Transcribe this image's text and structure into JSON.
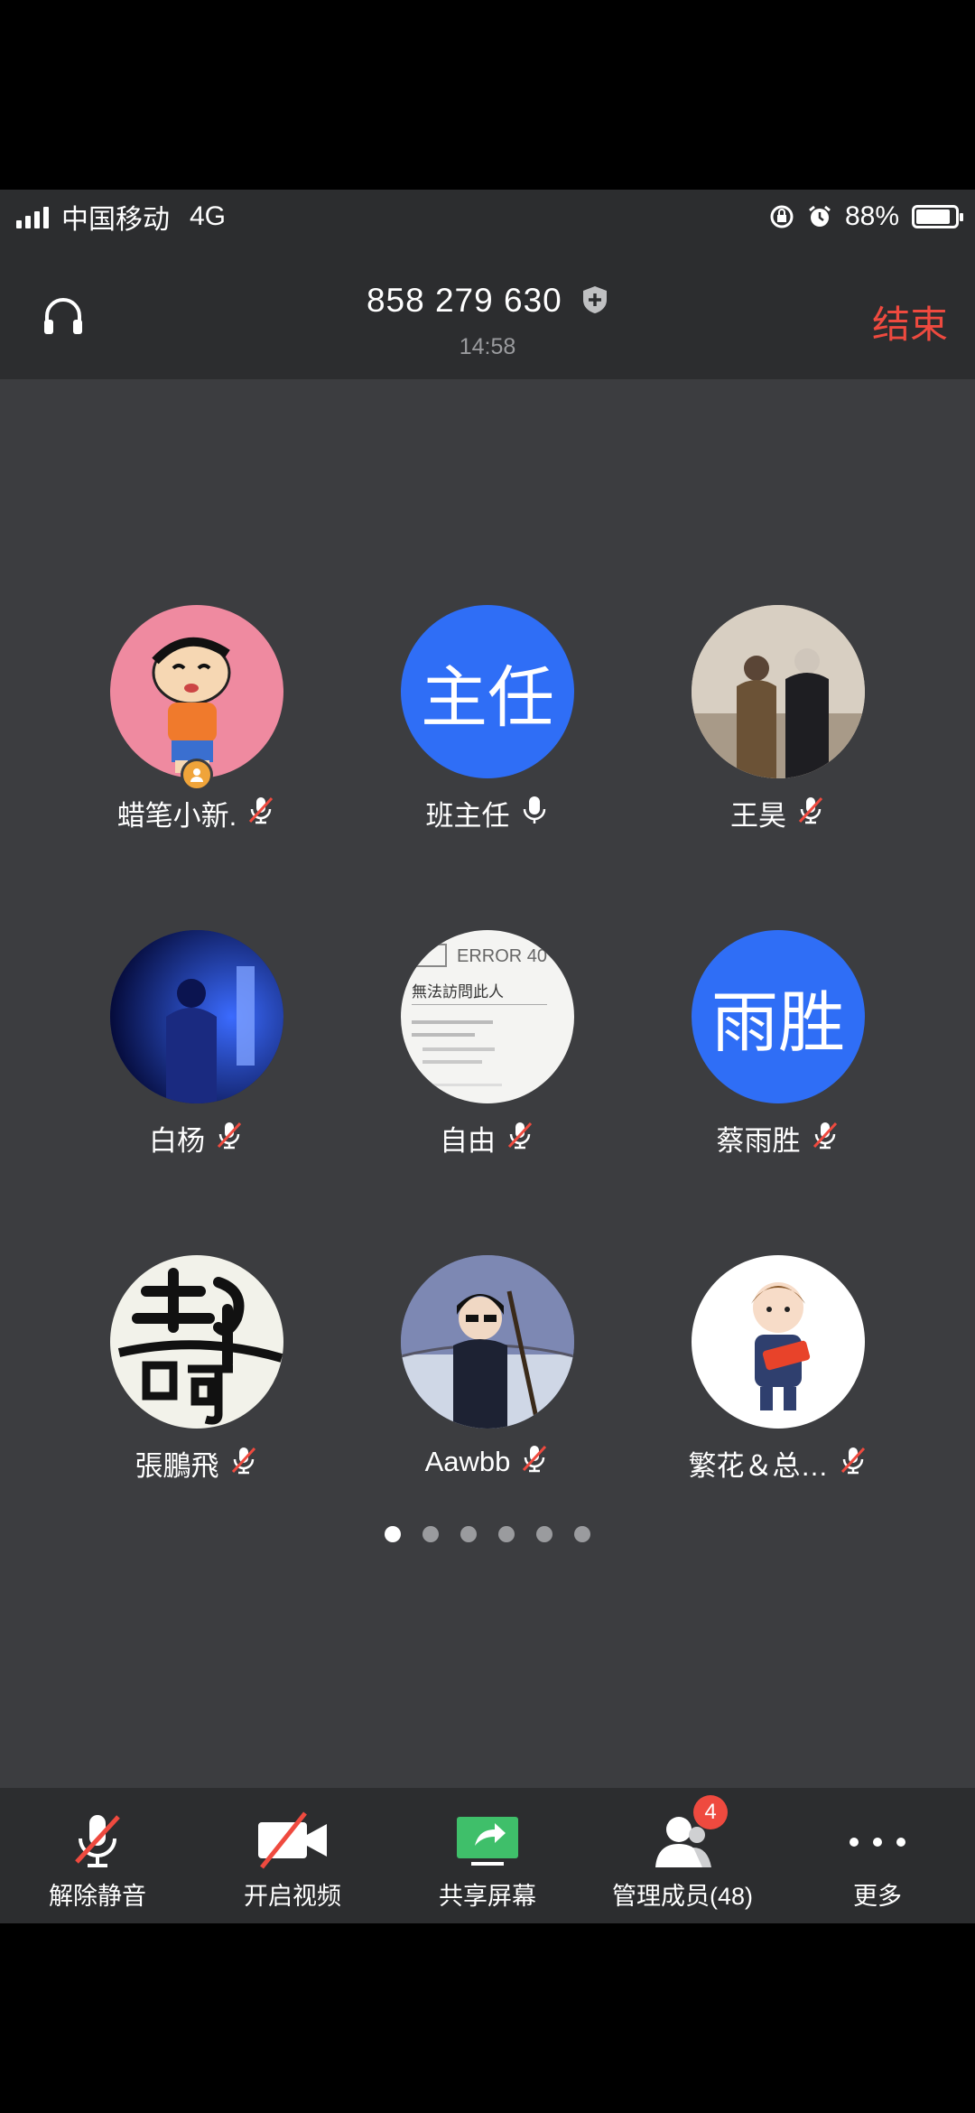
{
  "status_bar": {
    "carrier": "中国移动",
    "network": "4G",
    "battery": "88%",
    "battery_level": 0.88
  },
  "header": {
    "meeting_id": "858 279 630",
    "time": "14:58",
    "end_label": "结束"
  },
  "participants": [
    {
      "name": "蜡笔小新.",
      "avatar": "crayon-shinchan-image",
      "mic": "muted",
      "host": true
    },
    {
      "name": "班主任",
      "avatar_text": "主任",
      "mic": "on"
    },
    {
      "name": "王昊",
      "avatar": "couple-photo-image",
      "mic": "muted"
    },
    {
      "name": "白杨",
      "avatar": "blue-night-photo-image",
      "mic": "muted"
    },
    {
      "name": "自由",
      "avatar": "error-page-image",
      "avatar_caption": "ERROR 40",
      "avatar_caption2": "無法訪問此人",
      "mic": "muted"
    },
    {
      "name": "蔡雨胜",
      "avatar_text": "雨胜",
      "mic": "muted"
    },
    {
      "name": "張鵬飛",
      "avatar": "calligraphy-image",
      "mic": "muted"
    },
    {
      "name": "Aawbb",
      "avatar": "cartoon-boy-image",
      "mic": "muted"
    },
    {
      "name": "繁花＆总…",
      "avatar": "cartoon-kid-image",
      "mic": "muted"
    }
  ],
  "pagination": {
    "pages": 6,
    "current": 1
  },
  "toolbar": {
    "unmute": "解除静音",
    "video": "开启视频",
    "share": "共享屏幕",
    "members": "管理成员(48)",
    "members_badge": "4",
    "more": "更多"
  },
  "colors": {
    "accent_blue": "#2f6ef6",
    "end_red": "#ef4a3f",
    "share_green": "#3fbf6a"
  }
}
